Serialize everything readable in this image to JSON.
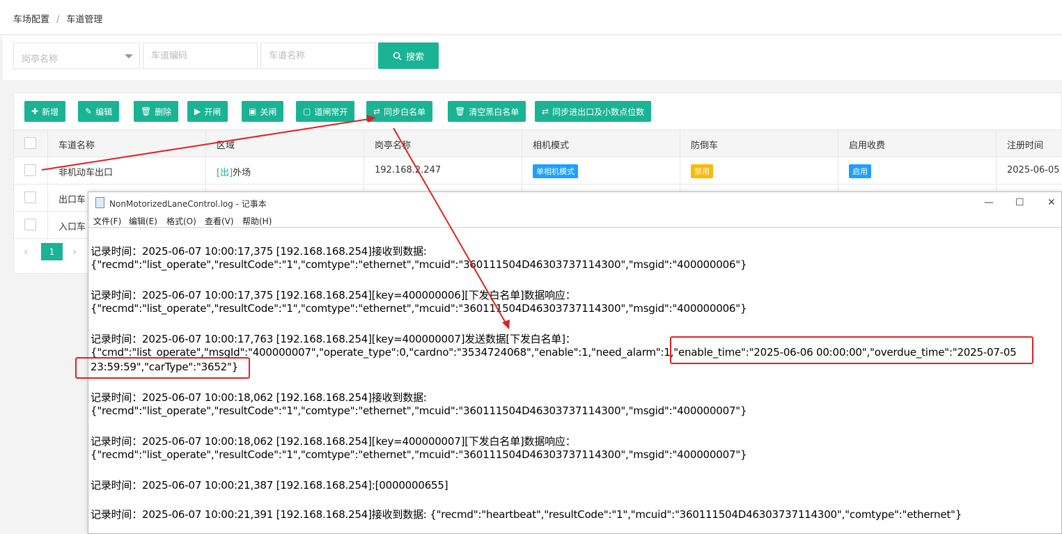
{
  "breadcrumb": {
    "level1": "车场配置",
    "separator": "/",
    "level2": "车道管理"
  },
  "search": {
    "booth_placeholder": "岗亭名称",
    "lane_code_placeholder": "车道编码",
    "lane_name_placeholder": "车道名称",
    "search_label": "搜索"
  },
  "toolbar": {
    "add": "新增",
    "edit": "编辑",
    "delete": "删除",
    "open_gate": "开闸",
    "close_gate": "关闸",
    "gate_always_open": "道闸常开",
    "sync_whitelist": "同步白名单",
    "clear_blackwhite": "清空黑白名单",
    "sync_decimal": "同步进出口及小数点位数"
  },
  "table": {
    "headers": [
      "车道名称",
      "区域",
      "岗亭名称",
      "相机模式",
      "防倒车",
      "启用收费",
      "注册时间"
    ],
    "rows": [
      {
        "name": "非机动车出口",
        "area_prefix": "[出]",
        "area": "外场",
        "booth": "192.168.2.247",
        "camera": "单相机模式",
        "anti_reverse": "禁用",
        "charge": "启用",
        "reg_time": "2025-06-05"
      },
      {
        "name": "出口车"
      },
      {
        "name": "入口车"
      }
    ],
    "page": "1"
  },
  "notepad": {
    "title": "NonMotorizedLaneControl.log - 记事本",
    "menu": [
      "文件(F)",
      "编辑(E)",
      "格式(O)",
      "查看(V)",
      "帮助(H)"
    ],
    "lines": [
      "记录时间：2025-06-07 10:00:17,375 [192.168.168.254]接收到数据:",
      "{\"recmd\":\"list_operate\",\"resultCode\":\"1\",\"comtype\":\"ethernet\",\"mcuid\":\"360111504D46303737114300\",\"msgid\":\"400000006\"}",
      "记录时间：2025-06-07 10:00:17,375 [192.168.168.254][key=400000006][下发白名单]数据响应：",
      "{\"recmd\":\"list_operate\",\"resultCode\":\"1\",\"comtype\":\"ethernet\",\"mcuid\":\"360111504D46303737114300\",\"msgid\":\"400000006\"}",
      "记录时间：2025-06-07 10:00:17,763 [192.168.168.254][key=400000007]发送数据[下发白名单]：",
      "{\"cmd\":\"list_operate\",\"msgId\":\"400000007\",\"operate_type\":0,\"cardno\":\"3534724068\",\"enable\":1,\"need_alarm\":1,\"enable_time\":\"2025-06-06 00:00:00\",\"overdue_time\":\"2025-07-05",
      "23:59:59\",\"carType\":\"3652\"}",
      "记录时间：2025-06-07 10:00:18,062 [192.168.168.254]接收到数据:",
      "{\"recmd\":\"list_operate\",\"resultCode\":\"1\",\"comtype\":\"ethernet\",\"mcuid\":\"360111504D46303737114300\",\"msgid\":\"400000007\"}",
      "记录时间：2025-06-07 10:00:18,062 [192.168.168.254][key=400000007][下发白名单]数据响应：",
      "{\"recmd\":\"list_operate\",\"resultCode\":\"1\",\"comtype\":\"ethernet\",\"mcuid\":\"360111504D46303737114300\",\"msgid\":\"400000007\"}",
      "记录时间：2025-06-07 10:00:21,387 [192.168.168.254]:[0000000655]",
      "记录时间：2025-06-07 10:00:21,391 [192.168.168.254]接收到数据: {\"recmd\":\"heartbeat\",\"resultCode\":\"1\",\"mcuid\":\"360111504D46303737114300\",\"comtype\":\"ethernet\"}"
    ]
  },
  "colors": {
    "primary": "#1ab394",
    "tag_blue": "#1e9fff",
    "tag_orange": "#ffb800",
    "annotation_red": "#e02020"
  },
  "icons": [
    "dropdown-caret-icon",
    "search-icon",
    "plus-icon",
    "edit-icon",
    "trash-icon",
    "play-icon",
    "stop-icon",
    "square-icon",
    "sync-icon",
    "notepad-icon",
    "minimize-icon",
    "maximize-icon",
    "close-icon",
    "chevron-left-icon",
    "chevron-right-icon"
  ]
}
